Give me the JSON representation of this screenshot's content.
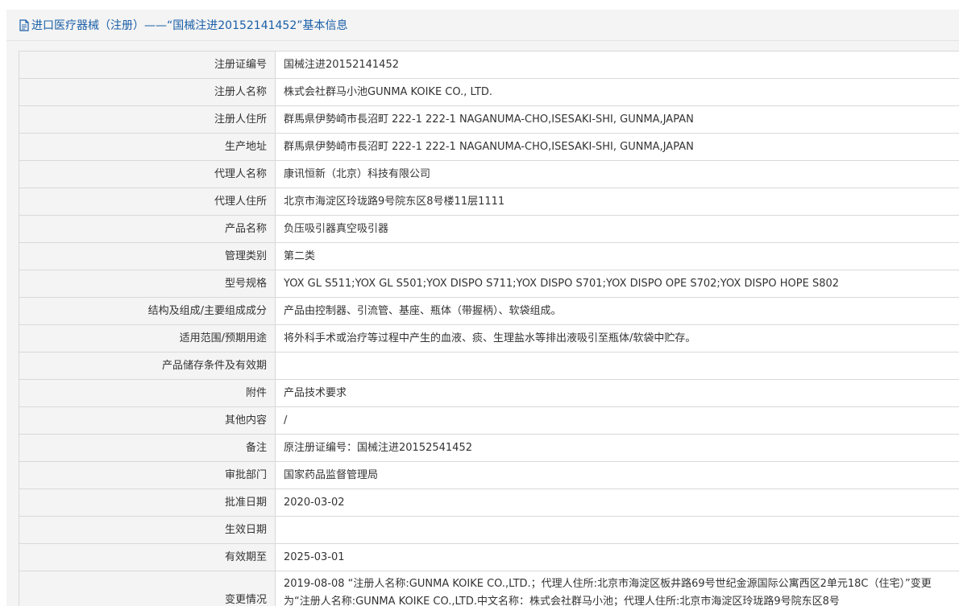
{
  "header": {
    "title": "进口医疗器械（注册）——“国械注进20152141452”基本信息"
  },
  "rows": [
    {
      "label": "注册证编号",
      "value": "国械注进20152141452"
    },
    {
      "label": "注册人名称",
      "value": "株式会社群马小池GUNMA KOIKE CO., LTD."
    },
    {
      "label": "注册人住所",
      "value": "群馬県伊勢崎市長沼町 222-1 222-1 NAGANUMA-CHO,ISESAKI-SHI, GUNMA,JAPAN"
    },
    {
      "label": "生产地址",
      "value": "群馬県伊勢崎市長沼町 222-1 222-1 NAGANUMA-CHO,ISESAKI-SHI, GUNMA,JAPAN"
    },
    {
      "label": "代理人名称",
      "value": "康讯恒新（北京）科技有限公司"
    },
    {
      "label": "代理人住所",
      "value": "北京市海淀区玲珑路9号院东区8号楼11层1111"
    },
    {
      "label": "产品名称",
      "value": "负压吸引器真空吸引器"
    },
    {
      "label": "管理类别",
      "value": "第二类"
    },
    {
      "label": "型号规格",
      "value": "YOX GL S511;YOX GL S501;YOX DISPO S711;YOX DISPO S701;YOX DISPO OPE S702;YOX DISPO HOPE S802"
    },
    {
      "label": "结构及组成/主要组成成分",
      "value": "产品由控制器、引流管、基座、瓶体（带握柄）、软袋组成。"
    },
    {
      "label": "适用范围/预期用途",
      "value": "将外科手术或治疗等过程中产生的血液、痰、生理盐水等排出液吸引至瓶体/软袋中贮存。"
    },
    {
      "label": "产品储存条件及有效期",
      "value": ""
    },
    {
      "label": "附件",
      "value": "产品技术要求"
    },
    {
      "label": "其他内容",
      "value": "/"
    },
    {
      "label": "备注",
      "value": "原注册证编号：国械注进20152541452"
    },
    {
      "label": "审批部门",
      "value": "国家药品监督管理局"
    },
    {
      "label": "批准日期",
      "value": "2020-03-02"
    },
    {
      "label": "生效日期",
      "value": ""
    },
    {
      "label": "有效期至",
      "value": "2025-03-01"
    },
    {
      "label": "变更情况",
      "value": "2019-08-08 “注册人名称:GUNMA KOIKE CO.,LTD.；代理人住所:北京市海淀区板井路69号世纪金源国际公寓西区2单元18C（住宅）”变更为“注册人名称:GUNMA KOIKE CO.,LTD.中文名称：株式会社群马小池；代理人住所:北京市海淀区玲珑路9号院东区8号"
    }
  ]
}
